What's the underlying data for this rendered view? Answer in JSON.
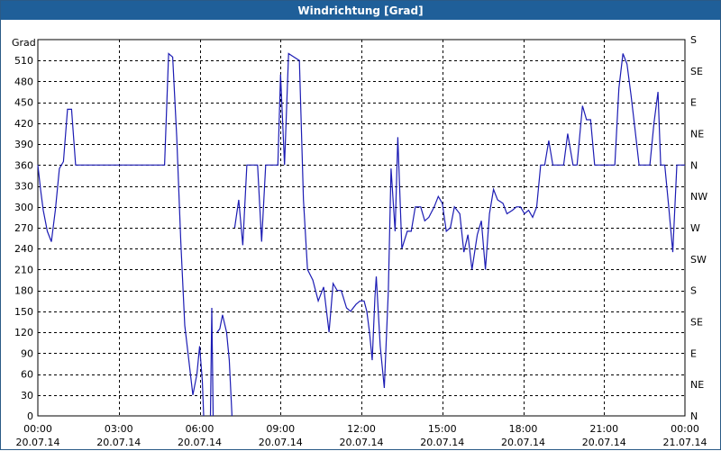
{
  "window": {
    "title": "Windrichtung [Grad]"
  },
  "colors": {
    "titlebar": "#1f5f99",
    "series": "#1c1cb4",
    "grid": "#000000"
  },
  "chart_data": {
    "type": "line",
    "title": "Windrichtung [Grad]",
    "ylabel": "Grad",
    "ylim": [
      0,
      540
    ],
    "xlim": [
      0,
      24
    ],
    "grid": true,
    "y_ticks": [
      0,
      30,
      60,
      90,
      120,
      150,
      180,
      210,
      240,
      270,
      300,
      330,
      360,
      390,
      420,
      450,
      480,
      510
    ],
    "right_axis_ticks": [
      {
        "value": 0,
        "label": "N"
      },
      {
        "value": 45,
        "label": "NE"
      },
      {
        "value": 90,
        "label": "E"
      },
      {
        "value": 135,
        "label": "SE"
      },
      {
        "value": 180,
        "label": "S"
      },
      {
        "value": 225,
        "label": "SW"
      },
      {
        "value": 270,
        "label": "W"
      },
      {
        "value": 315,
        "label": "NW"
      },
      {
        "value": 360,
        "label": "N"
      },
      {
        "value": 405,
        "label": "NE"
      },
      {
        "value": 450,
        "label": "E"
      },
      {
        "value": 495,
        "label": "SE"
      },
      {
        "value": 540,
        "label": "S"
      }
    ],
    "x_ticks": [
      {
        "value": 0,
        "time": "00:00",
        "date": "20.07.14"
      },
      {
        "value": 3,
        "time": "03:00",
        "date": "20.07.14"
      },
      {
        "value": 6,
        "time": "06:00",
        "date": "20.07.14"
      },
      {
        "value": 9,
        "time": "09:00",
        "date": "20.07.14"
      },
      {
        "value": 12,
        "time": "12:00",
        "date": "20.07.14"
      },
      {
        "value": 15,
        "time": "15:00",
        "date": "20.07.14"
      },
      {
        "value": 18,
        "time": "18:00",
        "date": "20.07.14"
      },
      {
        "value": 21,
        "time": "21:00",
        "date": "20.07.14"
      },
      {
        "value": 24,
        "time": "00:00",
        "date": "21.07.14"
      }
    ],
    "series": [
      {
        "segments": [
          [
            [
              0.0,
              360
            ],
            [
              0.1,
              325
            ],
            [
              0.2,
              295
            ],
            [
              0.35,
              265
            ],
            [
              0.5,
              250
            ],
            [
              0.65,
              295
            ],
            [
              0.8,
              355
            ],
            [
              0.95,
              365
            ],
            [
              1.1,
              440
            ],
            [
              1.25,
              440
            ],
            [
              1.4,
              360
            ],
            [
              2.0,
              360
            ],
            [
              3.0,
              360
            ],
            [
              4.0,
              360
            ],
            [
              4.5,
              360
            ],
            [
              4.7,
              360
            ],
            [
              4.85,
              520
            ],
            [
              5.0,
              515
            ],
            [
              5.15,
              400
            ],
            [
              5.3,
              250
            ],
            [
              5.45,
              130
            ],
            [
              5.6,
              80
            ],
            [
              5.75,
              30
            ],
            [
              5.9,
              60
            ],
            [
              6.0,
              100
            ],
            [
              6.1,
              50
            ],
            [
              6.15,
              0
            ]
          ],
          [
            [
              6.4,
              0
            ],
            [
              6.45,
              155
            ],
            [
              6.5,
              0
            ]
          ],
          [
            [
              6.65,
              120
            ],
            [
              6.75,
              125
            ],
            [
              6.85,
              145
            ],
            [
              7.0,
              120
            ],
            [
              7.1,
              80
            ],
            [
              7.2,
              0
            ]
          ],
          [
            [
              7.3,
              270
            ],
            [
              7.45,
              310
            ],
            [
              7.6,
              245
            ],
            [
              7.75,
              360
            ],
            [
              8.0,
              360
            ],
            [
              8.15,
              360
            ],
            [
              8.3,
              250
            ],
            [
              8.45,
              360
            ],
            [
              8.6,
              360
            ],
            [
              8.75,
              360
            ],
            [
              8.9,
              360
            ],
            [
              9.0,
              490
            ],
            [
              9.15,
              360
            ],
            [
              9.3,
              520
            ],
            [
              9.5,
              515
            ],
            [
              9.7,
              510
            ],
            [
              9.85,
              310
            ],
            [
              10.0,
              210
            ],
            [
              10.2,
              195
            ],
            [
              10.4,
              165
            ],
            [
              10.6,
              185
            ],
            [
              10.8,
              120
            ],
            [
              10.95,
              190
            ],
            [
              11.1,
              180
            ],
            [
              11.25,
              180
            ],
            [
              11.45,
              155
            ],
            [
              11.6,
              150
            ],
            [
              11.8,
              160
            ],
            [
              11.95,
              165
            ],
            [
              12.1,
              165
            ],
            [
              12.2,
              150
            ],
            [
              12.3,
              120
            ],
            [
              12.4,
              80
            ],
            [
              12.5,
              170
            ],
            [
              12.55,
              200
            ],
            [
              12.7,
              100
            ],
            [
              12.85,
              40
            ],
            [
              13.0,
              180
            ],
            [
              13.1,
              355
            ],
            [
              13.25,
              265
            ],
            [
              13.35,
              400
            ],
            [
              13.5,
              240
            ],
            [
              13.7,
              265
            ],
            [
              13.85,
              265
            ],
            [
              14.0,
              300
            ],
            [
              14.2,
              300
            ],
            [
              14.35,
              280
            ],
            [
              14.5,
              285
            ],
            [
              14.7,
              300
            ],
            [
              14.85,
              315
            ],
            [
              15.0,
              305
            ],
            [
              15.15,
              265
            ],
            [
              15.3,
              270
            ],
            [
              15.45,
              300
            ],
            [
              15.65,
              290
            ],
            [
              15.8,
              235
            ],
            [
              15.95,
              260
            ],
            [
              16.1,
              210
            ],
            [
              16.3,
              260
            ],
            [
              16.45,
              280
            ],
            [
              16.6,
              210
            ],
            [
              16.75,
              290
            ],
            [
              16.9,
              325
            ],
            [
              17.05,
              310
            ],
            [
              17.25,
              305
            ],
            [
              17.4,
              290
            ],
            [
              17.6,
              295
            ],
            [
              17.75,
              300
            ],
            [
              17.9,
              300
            ],
            [
              18.05,
              290
            ],
            [
              18.2,
              295
            ],
            [
              18.35,
              285
            ],
            [
              18.5,
              300
            ],
            [
              18.65,
              360
            ],
            [
              18.8,
              360
            ],
            [
              18.95,
              395
            ],
            [
              19.1,
              360
            ],
            [
              19.3,
              360
            ],
            [
              19.5,
              360
            ],
            [
              19.65,
              405
            ],
            [
              19.85,
              360
            ],
            [
              20.0,
              360
            ],
            [
              20.2,
              445
            ],
            [
              20.35,
              425
            ],
            [
              20.5,
              425
            ],
            [
              20.65,
              360
            ],
            [
              20.8,
              360
            ],
            [
              21.0,
              360
            ],
            [
              21.2,
              360
            ],
            [
              21.4,
              360
            ],
            [
              21.55,
              470
            ],
            [
              21.7,
              520
            ],
            [
              21.85,
              505
            ],
            [
              22.0,
              460
            ],
            [
              22.15,
              410
            ],
            [
              22.3,
              360
            ],
            [
              22.5,
              360
            ],
            [
              22.7,
              360
            ],
            [
              22.85,
              420
            ],
            [
              23.0,
              465
            ],
            [
              23.1,
              360
            ],
            [
              23.25,
              360
            ],
            [
              23.4,
              300
            ],
            [
              23.55,
              235
            ],
            [
              23.7,
              360
            ],
            [
              23.85,
              360
            ],
            [
              24.0,
              360
            ]
          ]
        ]
      }
    ]
  }
}
